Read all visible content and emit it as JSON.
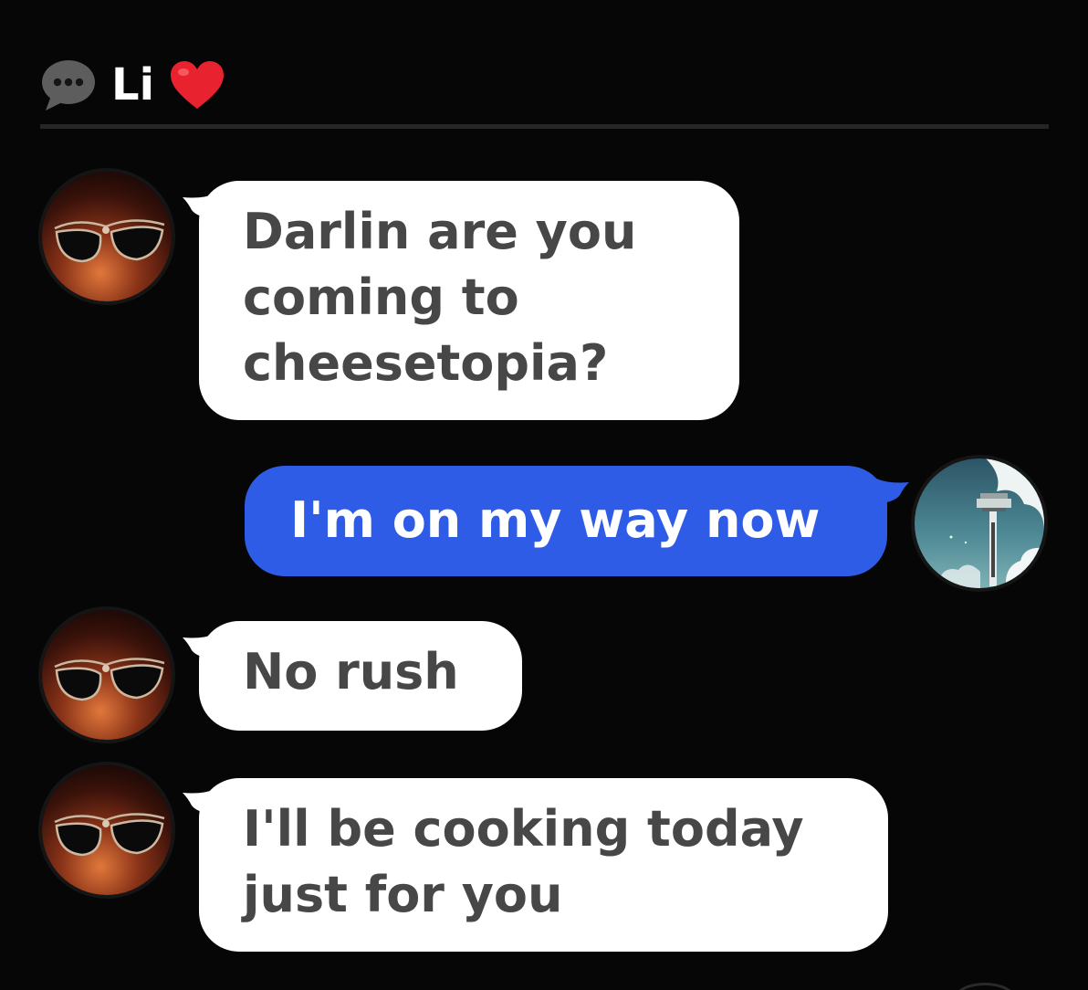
{
  "header": {
    "icon": "chat-bubble-icon",
    "title": "Li",
    "emoji": "heart-icon",
    "heart_color": "#e8232f"
  },
  "messages": [
    {
      "direction": "incoming",
      "avatar": "glasses-avatar",
      "text": "Darlin are you coming to cheesetopia?"
    },
    {
      "direction": "outgoing",
      "avatar": "tower-sky-avatar",
      "text": "I'm on my way now"
    },
    {
      "direction": "incoming",
      "avatar": "glasses-avatar",
      "text": "No rush"
    },
    {
      "direction": "incoming",
      "avatar": "glasses-avatar",
      "text": "I'll be cooking today just for you"
    }
  ],
  "colors": {
    "background": "#060606",
    "incoming_bubble": "#ffffff",
    "incoming_text": "#474747",
    "outgoing_bubble": "#2f5ce6",
    "outgoing_text": "#ffffff"
  }
}
